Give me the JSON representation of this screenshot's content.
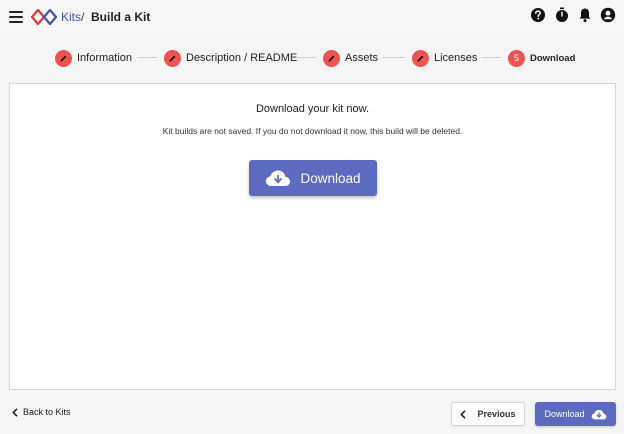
{
  "header": {
    "breadcrumb_link": "Kits",
    "breadcrumb_separator": "/",
    "breadcrumb_current": "Build a Kit",
    "icons": [
      "menu-icon",
      "help-icon",
      "timer-icon",
      "notifications-icon",
      "account-icon"
    ]
  },
  "stepper": {
    "steps": [
      {
        "label": "Information",
        "state": "completed",
        "icon": "pencil-icon"
      },
      {
        "label": "Description / README",
        "state": "completed",
        "icon": "pencil-icon"
      },
      {
        "label": "Assets",
        "state": "completed",
        "icon": "pencil-icon"
      },
      {
        "label": "Licenses",
        "state": "completed",
        "icon": "pencil-icon"
      },
      {
        "label": "Download",
        "state": "active",
        "number": "5"
      }
    ]
  },
  "main": {
    "title": "Download your kit now.",
    "subtitle": "Kit builds are not saved. If you do not download it now, this build will be deleted.",
    "download_button": "Download"
  },
  "footer": {
    "back_label": "Back to Kits",
    "previous_label": "Previous",
    "download_label": "Download"
  },
  "colors": {
    "accent": "#5c6bc0",
    "step": "#ef5350",
    "link": "#3f51b5"
  }
}
